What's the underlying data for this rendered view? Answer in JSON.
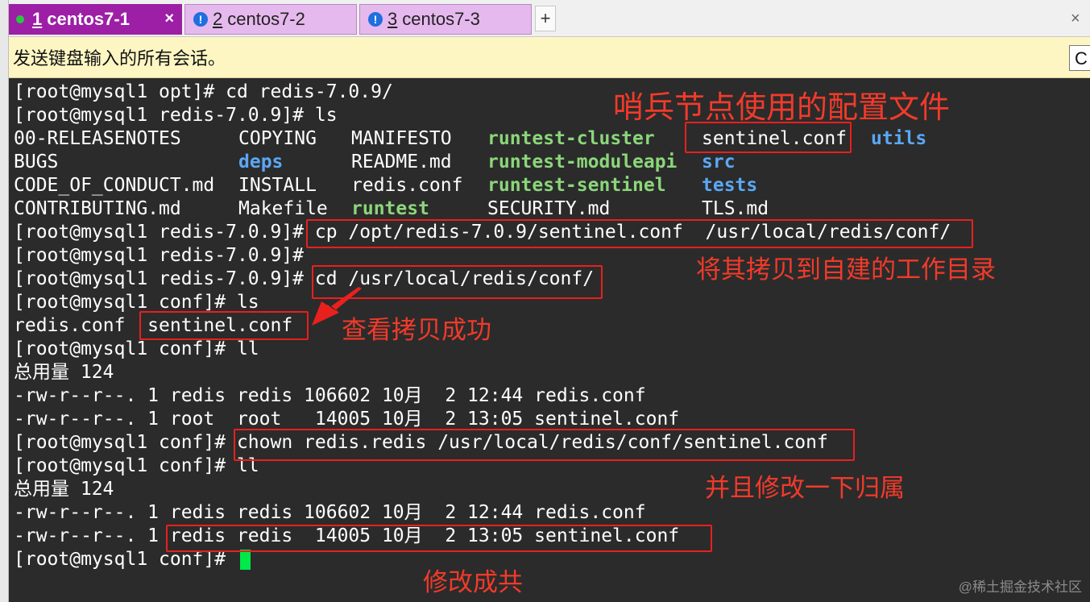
{
  "tabs": [
    {
      "num": "1",
      "label": "centos7-1",
      "close": "×",
      "status": "connected"
    },
    {
      "num": "2",
      "label": "centos7-2",
      "icon": "!",
      "status": "warning"
    },
    {
      "num": "3",
      "label": "centos7-3",
      "icon": "!",
      "status": "warning"
    }
  ],
  "new_tab_label": "+",
  "window_close": "×",
  "notice": {
    "text": "发送键盘输入的所有会话。",
    "button": "C"
  },
  "terminal": {
    "lines": [
      "[root@mysql1 opt]# cd redis-7.0.9/",
      "[root@mysql1 redis-7.0.9]# ls"
    ],
    "ls_rows": [
      [
        {
          "t": "00-RELEASENOTES",
          "c": "w"
        },
        {
          "t": "COPYING",
          "c": "w"
        },
        {
          "t": "MANIFESTO",
          "c": "w"
        },
        {
          "t": "runtest-cluster",
          "c": "g"
        },
        {
          "t": "sentinel.conf",
          "c": "w"
        },
        {
          "t": "utils",
          "c": "b"
        }
      ],
      [
        {
          "t": "BUGS",
          "c": "w"
        },
        {
          "t": "deps",
          "c": "b"
        },
        {
          "t": "README.md",
          "c": "w"
        },
        {
          "t": "runtest-moduleapi",
          "c": "g"
        },
        {
          "t": "src",
          "c": "b"
        }
      ],
      [
        {
          "t": "CODE_OF_CONDUCT.md",
          "c": "w"
        },
        {
          "t": "INSTALL",
          "c": "w"
        },
        {
          "t": "redis.conf",
          "c": "w"
        },
        {
          "t": "runtest-sentinel",
          "c": "g"
        },
        {
          "t": "tests",
          "c": "b"
        }
      ],
      [
        {
          "t": "CONTRIBUTING.md",
          "c": "w"
        },
        {
          "t": "Makefile",
          "c": "w"
        },
        {
          "t": "runtest",
          "c": "g"
        },
        {
          "t": "SECURITY.md",
          "c": "w"
        },
        {
          "t": "TLS.md",
          "c": "w"
        }
      ]
    ],
    "after": [
      "[root@mysql1 redis-7.0.9]# cp /opt/redis-7.0.9/sentinel.conf  /usr/local/redis/conf/",
      "[root@mysql1 redis-7.0.9]#",
      "[root@mysql1 redis-7.0.9]# cd /usr/local/redis/conf/",
      "[root@mysql1 conf]# ls",
      "redis.conf  sentinel.conf",
      "[root@mysql1 conf]# ll",
      "总用量 124",
      "-rw-r--r--. 1 redis redis 106602 10月  2 12:44 redis.conf",
      "-rw-r--r--. 1 root  root   14005 10月  2 13:05 sentinel.conf",
      "[root@mysql1 conf]# chown redis.redis /usr/local/redis/conf/sentinel.conf",
      "[root@mysql1 conf]# ll",
      "总用量 124",
      "-rw-r--r--. 1 redis redis 106602 10月  2 12:44 redis.conf",
      "-rw-r--r--. 1 redis redis  14005 10月  2 13:05 sentinel.conf",
      "[root@mysql1 conf]# "
    ]
  },
  "annotations": {
    "sentinel_config": "哨兵节点使用的配置文件",
    "copy_to_dir": "将其拷贝到自建的工作目录",
    "copy_success": "查看拷贝成功",
    "change_owner": "并且修改一下归属",
    "modified": "修改成共"
  },
  "watermark": "@稀土掘金技术社区",
  "colors": {
    "tab_active": "#9d1fa6",
    "tab_inactive": "#e6b9ee",
    "terminal_bg": "#2b2b2b",
    "exec_green": "#8bd67a",
    "dir_blue": "#5aa8f5",
    "annotation_red": "#f23a2a",
    "cursor": "#00e84a"
  }
}
